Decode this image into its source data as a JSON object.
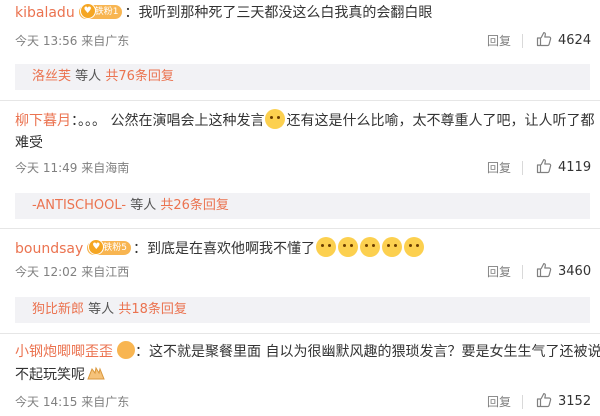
{
  "comments": [
    {
      "user": "kibaladu",
      "badge": "铁粉1",
      "sep": "：",
      "text": "我听到那种死了三天都没这么白我真的会翻白眼",
      "time": "今天 13:56",
      "location": "来自广东",
      "reply": "回复",
      "likes": "4624",
      "sub": {
        "user": "洛丝芙",
        "others": "等人",
        "count": "共76条回复"
      }
    },
    {
      "user": "柳下暮月",
      "sep": "：",
      "text_a": "。。。 公然在演唱会上这种发言",
      "text_b": "还有这是什么比喻，太不尊重人了吧，让人听了都",
      "text_c": "难受",
      "time": "今天 11:49",
      "location": "来自海南",
      "reply": "回复",
      "likes": "4119",
      "sub": {
        "user": "-ANTISCHOOL-",
        "others": "等人",
        "count": "共26条回复"
      }
    },
    {
      "user": "boundsay",
      "badge": "铁粉5",
      "sep": "：",
      "text": "到底是在喜欢他啊我不懂了",
      "time": "今天 12:02",
      "location": "来自江西",
      "reply": "回复",
      "likes": "3460",
      "sub": {
        "user": "狗比新郎",
        "others": "等人",
        "count": "共18条回复"
      }
    },
    {
      "user": "小钢炮唧唧歪歪",
      "sep": "：",
      "text_a": "这不就是聚餐里面 自以为很幽默风趣的猥琐发言？要是女生生气了还被说开",
      "text_b": "不起玩笑呢",
      "time": "今天 14:15",
      "location": "来自广东",
      "reply": "回复",
      "likes": "3152"
    }
  ],
  "icons": {
    "like": "thumbs-up-icon",
    "badge": "fan-badge-icon",
    "emoji": "sweat-emoji-icon"
  },
  "colors": {
    "username": "#eb7350",
    "meta": "#808080",
    "subbox_bg": "#f2f2f5",
    "badge": "#f8b551"
  }
}
